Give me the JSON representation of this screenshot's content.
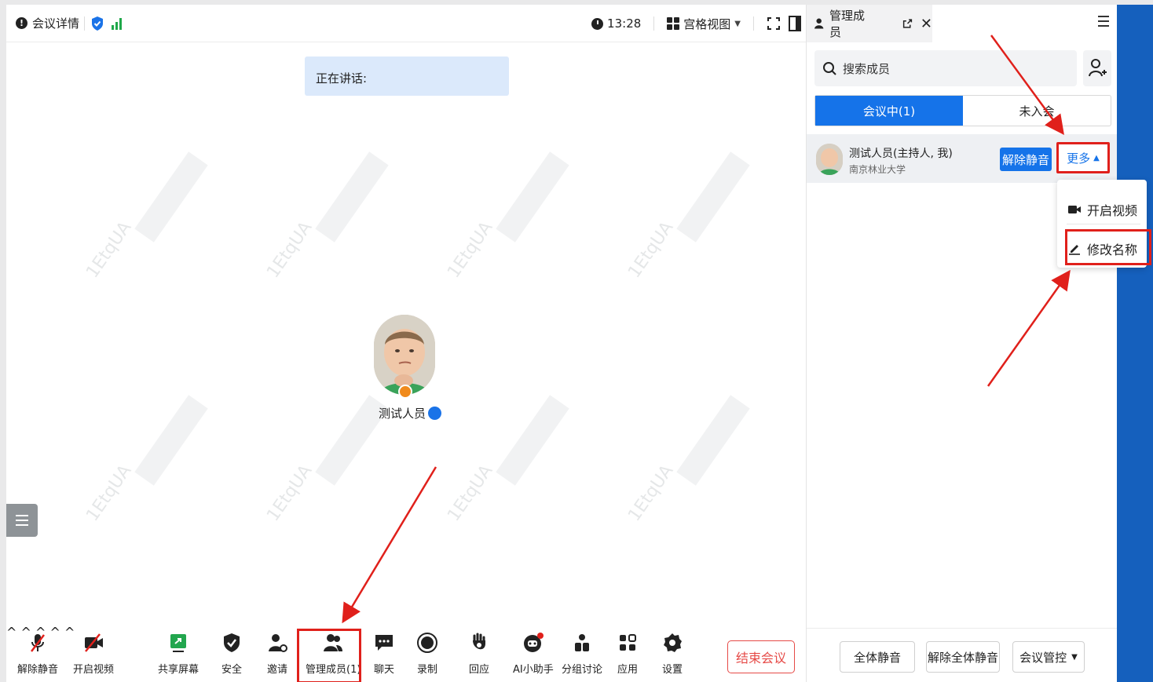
{
  "topbar": {
    "meeting_details": "会议详情",
    "time": "13:28",
    "view_mode": "宫格视图"
  },
  "stage": {
    "speaking_label": "正在讲话:",
    "participant_name": "测试人员",
    "watermark": "1EtqUA"
  },
  "toolbar": {
    "unmute": "解除静音",
    "start_video": "开启视频",
    "share_screen": "共享屏幕",
    "security": "安全",
    "invite": "邀请",
    "manage_members": "管理成员(1)",
    "chat": "聊天",
    "record": "录制",
    "reactions": "回应",
    "ai_assistant": "AI小助手",
    "breakout": "分组讨论",
    "apps": "应用",
    "settings": "设置",
    "end_meeting": "结束会议"
  },
  "panel": {
    "title": "管理成员",
    "search_placeholder": "搜索成员",
    "tab_in_meeting": "会议中(1)",
    "tab_not_joined": "未入会",
    "member": {
      "name": "测试人员(主持人, 我)",
      "org": "南京林业大学",
      "unmute_label": "解除静音",
      "more_label": "更多"
    },
    "more_menu": {
      "start_video": "开启视频",
      "rename": "修改名称"
    },
    "footer": {
      "mute_all": "全体静音",
      "unmute_all": "解除全体静音",
      "meeting_control": "会议管控"
    }
  },
  "colors": {
    "accent": "#1573e9",
    "annotation_red": "#e0201b",
    "end_red": "#e64a47",
    "outer_blue": "#1560bd"
  }
}
